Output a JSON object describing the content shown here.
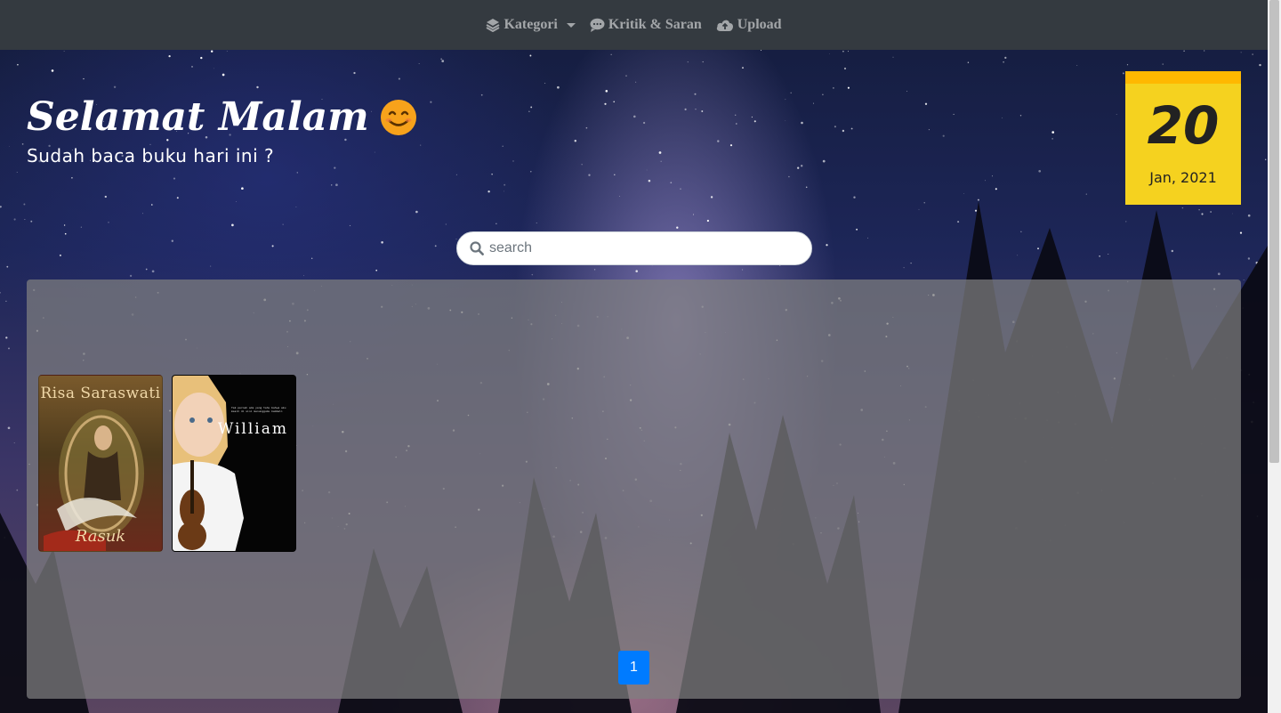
{
  "navbar": {
    "items": [
      {
        "label": "Kategori",
        "icon": "layers-icon",
        "has_dropdown": true
      },
      {
        "label": "Kritik & Saran",
        "icon": "comment-icon",
        "has_dropdown": false
      },
      {
        "label": "Upload",
        "icon": "cloud-upload-icon",
        "has_dropdown": false
      }
    ]
  },
  "greeting": {
    "title": "Selamat Malam",
    "emoji": "😊",
    "subtitle": "Sudah baca buku hari ini ?"
  },
  "calendar": {
    "day": "20",
    "month_year": "Jan, 2021"
  },
  "search": {
    "placeholder": "search",
    "value": ""
  },
  "books": [
    {
      "author": "Risa Saraswati",
      "title": "Rasuk"
    },
    {
      "title": "William",
      "blurb": "Tak pernah ada yang tahu bahwa aku masih di sini menunggumu kembali"
    }
  ],
  "pagination": {
    "current_page": "1"
  },
  "colors": {
    "navbar_bg": "#343a40",
    "calendar_bg": "#f5d21f",
    "calendar_top": "#ffb800",
    "pager_active": "#007bff"
  }
}
